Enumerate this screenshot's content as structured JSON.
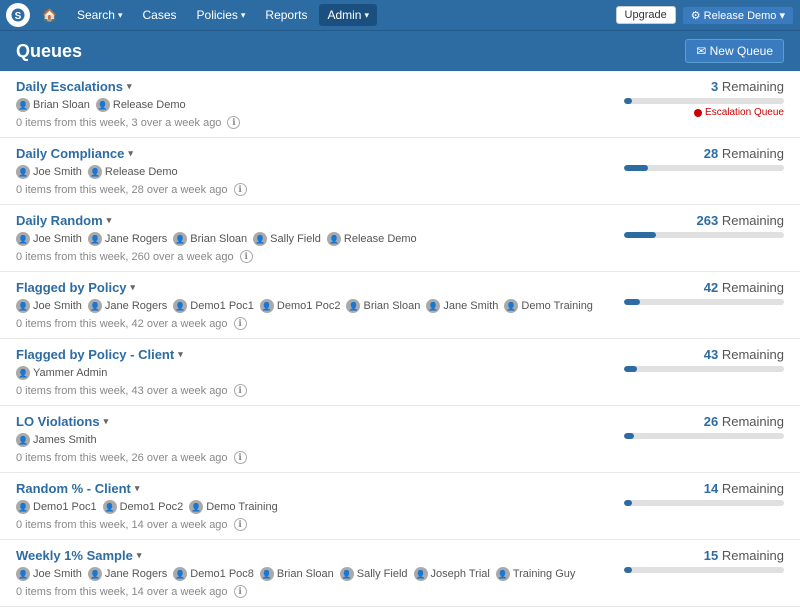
{
  "navbar": {
    "brand_icon": "S",
    "items": [
      {
        "label": "🏠",
        "id": "home",
        "dropdown": false
      },
      {
        "label": "Search",
        "id": "search",
        "dropdown": true
      },
      {
        "label": "Cases",
        "id": "cases",
        "dropdown": false
      },
      {
        "label": "Policies",
        "id": "policies",
        "dropdown": true
      },
      {
        "label": "Reports",
        "id": "reports",
        "dropdown": false
      },
      {
        "label": "Admin",
        "id": "admin",
        "dropdown": true,
        "active": true
      }
    ],
    "upgrade_label": "Upgrade",
    "release_demo_label": "⚙ Release Demo ▾"
  },
  "page": {
    "title": "Queues",
    "new_queue_label": "✉ New Queue"
  },
  "queues": [
    {
      "id": "daily-escalations",
      "name": "Daily Escalations",
      "remaining": 3,
      "remaining_label": "3 Remaining",
      "users": [
        {
          "name": "Brian Sloan"
        },
        {
          "name": "Release Demo"
        }
      ],
      "meta": "0 items from this week, 3 over a week ago",
      "progress": 5,
      "escalation": true,
      "escalation_label": "Escalation Queue"
    },
    {
      "id": "daily-compliance",
      "name": "Daily Compliance",
      "remaining": 28,
      "remaining_label": "28 Remaining",
      "users": [
        {
          "name": "Joe Smith"
        },
        {
          "name": "Release Demo"
        }
      ],
      "meta": "0 items from this week, 28 over a week ago",
      "progress": 15,
      "escalation": false
    },
    {
      "id": "daily-random",
      "name": "Daily Random",
      "remaining": 263,
      "remaining_label": "263 Remaining",
      "users": [
        {
          "name": "Joe Smith"
        },
        {
          "name": "Jane Rogers"
        },
        {
          "name": "Brian Sloan"
        },
        {
          "name": "Sally Field"
        },
        {
          "name": "Release Demo"
        }
      ],
      "meta": "0 items from this week, 260 over a week ago",
      "progress": 20,
      "escalation": false
    },
    {
      "id": "flagged-by-policy",
      "name": "Flagged by Policy",
      "remaining": 42,
      "remaining_label": "42 Remaining",
      "users": [
        {
          "name": "Joe Smith"
        },
        {
          "name": "Jane Rogers"
        },
        {
          "name": "Demo1 Poc1"
        },
        {
          "name": "Demo1 Poc2"
        },
        {
          "name": "Brian Sloan"
        },
        {
          "name": "Jane Smith"
        },
        {
          "name": "Demo Training"
        }
      ],
      "meta": "0 items from this week, 42 over a week ago",
      "progress": 10,
      "escalation": false
    },
    {
      "id": "flagged-by-policy-client",
      "name": "Flagged by Policy - Client",
      "remaining": 43,
      "remaining_label": "43 Remaining",
      "users": [
        {
          "name": "Yammer Admin"
        }
      ],
      "meta": "0 items from this week, 43 over a week ago",
      "progress": 8,
      "escalation": false
    },
    {
      "id": "lo-violations",
      "name": "LO Violations",
      "remaining": 26,
      "remaining_label": "26 Remaining",
      "users": [
        {
          "name": "James Smith"
        }
      ],
      "meta": "0 items from this week, 26 over a week ago",
      "progress": 6,
      "escalation": false
    },
    {
      "id": "random-pct-client",
      "name": "Random % - Client",
      "remaining": 14,
      "remaining_label": "14 Remaining",
      "users": [
        {
          "name": "Demo1 Poc1"
        },
        {
          "name": "Demo1 Poc2"
        },
        {
          "name": "Demo Training"
        }
      ],
      "meta": "0 items from this week, 14 over a week ago",
      "progress": 5,
      "escalation": false
    },
    {
      "id": "weekly-1pct-sample",
      "name": "Weekly 1% Sample",
      "remaining": 15,
      "remaining_label": "15 Remaining",
      "users": [
        {
          "name": "Joe Smith"
        },
        {
          "name": "Jane Rogers"
        },
        {
          "name": "Demo1 Poc8"
        },
        {
          "name": "Brian Sloan"
        },
        {
          "name": "Sally Field"
        },
        {
          "name": "Joseph Trial"
        },
        {
          "name": "Training Guy"
        }
      ],
      "meta": "0 items from this week, 14 over a week ago",
      "progress": 5,
      "escalation": false
    }
  ]
}
